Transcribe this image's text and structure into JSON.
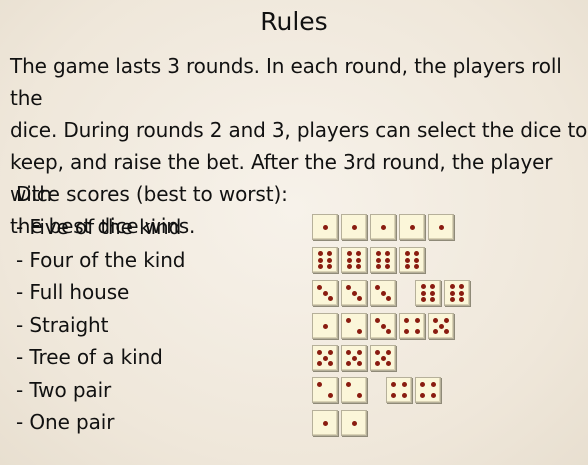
{
  "title": "Rules",
  "intro_lines": [
    "The game lasts 3 rounds. In each round, the players roll the",
    "dice. During rounds 2 and 3, players can select the dice to",
    "keep, and raise the bet. After the 3rd round, the player with",
    "the best dice wins."
  ],
  "scores_title": "Dice scores (best to worst):",
  "scores": [
    {
      "label": "- Five of the kind",
      "groups": [
        [
          1,
          1,
          1,
          1,
          1
        ]
      ]
    },
    {
      "label": "- Four of the kind",
      "groups": [
        [
          6,
          6,
          6,
          6
        ]
      ]
    },
    {
      "label": "- Full house",
      "groups": [
        [
          3,
          3,
          3
        ],
        [
          6,
          6
        ]
      ]
    },
    {
      "label": "- Straight",
      "groups": [
        [
          1,
          2,
          3,
          4,
          5
        ]
      ]
    },
    {
      "label": "- Tree of a kind",
      "groups": [
        [
          5,
          5,
          5
        ]
      ]
    },
    {
      "label": "- Two pair",
      "groups": [
        [
          2,
          2
        ],
        [
          4,
          4
        ]
      ]
    },
    {
      "label": "- One pair",
      "groups": [
        [
          1,
          1
        ]
      ]
    }
  ],
  "colors": {
    "background": "#f2ebdf",
    "die_face": "#fbf6d9",
    "pip": "#8a1c10",
    "text": "#111111"
  }
}
